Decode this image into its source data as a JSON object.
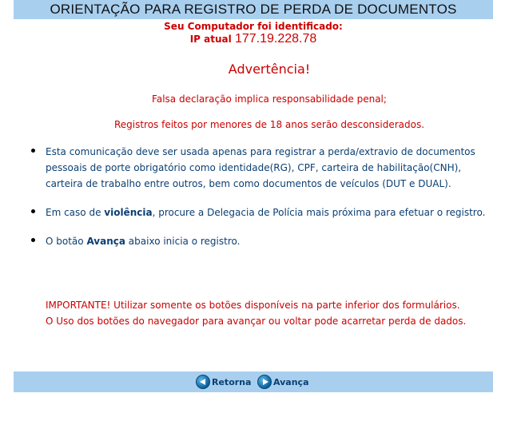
{
  "header": {
    "title": "ORIENTAÇÃO PARA REGISTRO DE PERDA DE DOCUMENTOS"
  },
  "identification": {
    "line1": "Seu Computador foi identificado:",
    "ip_label": "IP atual",
    "ip_value": "177.19.228.78"
  },
  "warning": {
    "title": "Advertência!",
    "line1": "Falsa declaração implica responsabilidade penal;",
    "line2": "Registros feitos por menores de 18 anos serão desconsiderados."
  },
  "bullets": [
    {
      "text": "Esta comunicação deve ser usada apenas para registrar a perda/extravio de documentos pessoais de porte obrigatório como identidade(RG), CPF, carteira de habilitação(CNH), carteira de trabalho entre outros, bem como documentos de veículos (DUT e DUAL)."
    },
    {
      "pre": "Em caso de ",
      "bold": "violência",
      "post": ", procure a Delegacia de Polícia mais próxima para efetuar o registro."
    },
    {
      "pre": "O botão ",
      "bold": "Avança",
      "post": " abaixo inicia o registro."
    }
  ],
  "important": {
    "line1": "IMPORTANTE! Utilizar somente os botões disponíveis na parte inferior dos formulários.",
    "line2": "O Uso dos botões do navegador para avançar ou voltar pode acarretar perda de dados."
  },
  "footer": {
    "back_label": "Retorna",
    "next_label": "Avança"
  },
  "colors": {
    "bar_blue": "#a9cfef",
    "alert_red": "#cc0000",
    "text_navy": "#0b3f73"
  },
  "icons": {
    "back": "back-arrow-icon",
    "next": "forward-arrow-icon"
  }
}
